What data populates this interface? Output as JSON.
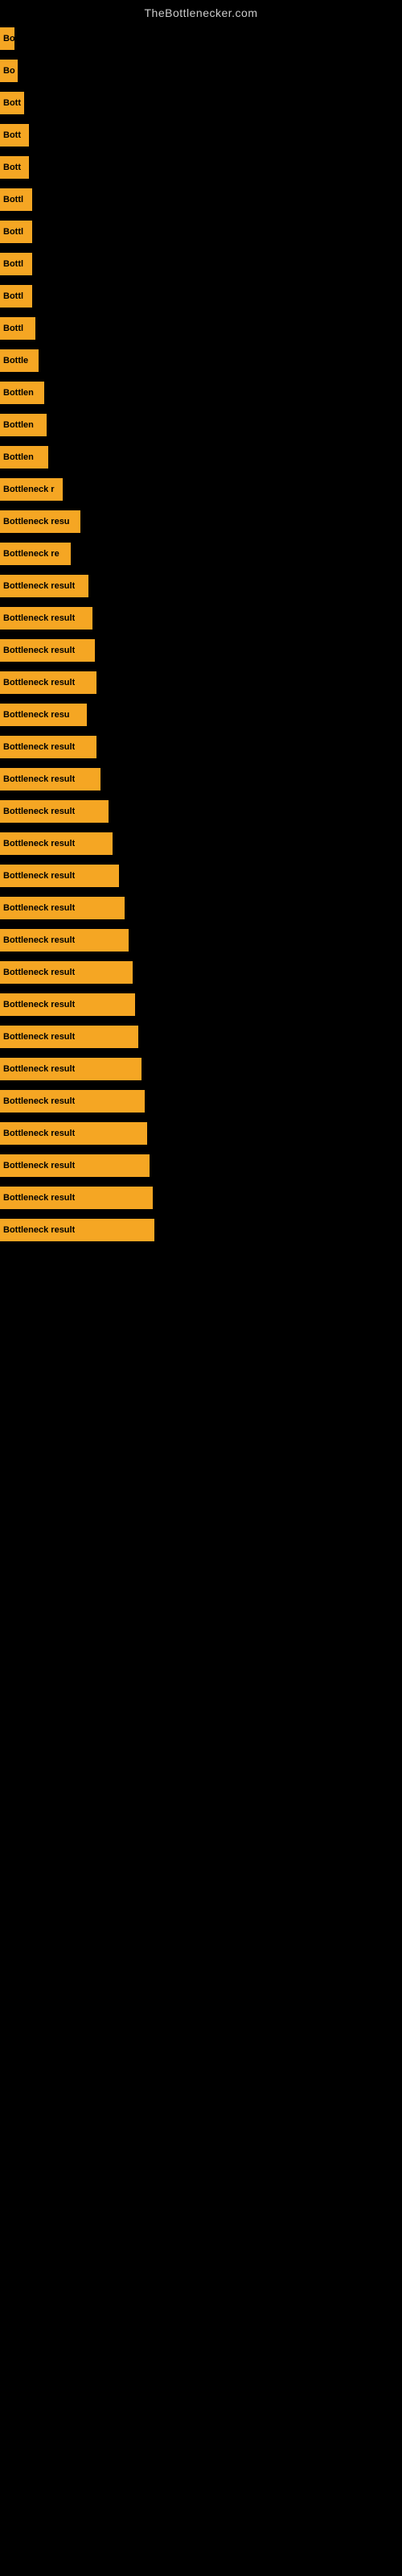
{
  "site_title": "TheBottlenecker.com",
  "bars": [
    {
      "label": "Bo",
      "width": 18
    },
    {
      "label": "Bo",
      "width": 22
    },
    {
      "label": "Bott",
      "width": 30
    },
    {
      "label": "Bott",
      "width": 36
    },
    {
      "label": "Bott",
      "width": 36
    },
    {
      "label": "Bottl",
      "width": 40
    },
    {
      "label": "Bottl",
      "width": 40
    },
    {
      "label": "Bottl",
      "width": 40
    },
    {
      "label": "Bottl",
      "width": 40
    },
    {
      "label": "Bottl",
      "width": 44
    },
    {
      "label": "Bottle",
      "width": 48
    },
    {
      "label": "Bottlen",
      "width": 55
    },
    {
      "label": "Bottlen",
      "width": 58
    },
    {
      "label": "Bottlen",
      "width": 60
    },
    {
      "label": "Bottleneck r",
      "width": 78
    },
    {
      "label": "Bottleneck resu",
      "width": 100
    },
    {
      "label": "Bottleneck re",
      "width": 88
    },
    {
      "label": "Bottleneck result",
      "width": 110
    },
    {
      "label": "Bottleneck result",
      "width": 115
    },
    {
      "label": "Bottleneck result",
      "width": 118
    },
    {
      "label": "Bottleneck result",
      "width": 120
    },
    {
      "label": "Bottleneck resu",
      "width": 108
    },
    {
      "label": "Bottleneck result",
      "width": 120
    },
    {
      "label": "Bottleneck result",
      "width": 125
    },
    {
      "label": "Bottleneck result",
      "width": 135
    },
    {
      "label": "Bottleneck result",
      "width": 140
    },
    {
      "label": "Bottleneck result",
      "width": 148
    },
    {
      "label": "Bottleneck result",
      "width": 155
    },
    {
      "label": "Bottleneck result",
      "width": 160
    },
    {
      "label": "Bottleneck result",
      "width": 165
    },
    {
      "label": "Bottleneck result",
      "width": 168
    },
    {
      "label": "Bottleneck result",
      "width": 172
    },
    {
      "label": "Bottleneck result",
      "width": 176
    },
    {
      "label": "Bottleneck result",
      "width": 180
    },
    {
      "label": "Bottleneck result",
      "width": 183
    },
    {
      "label": "Bottleneck result",
      "width": 186
    },
    {
      "label": "Bottleneck result",
      "width": 190
    },
    {
      "label": "Bottleneck result",
      "width": 192
    }
  ]
}
